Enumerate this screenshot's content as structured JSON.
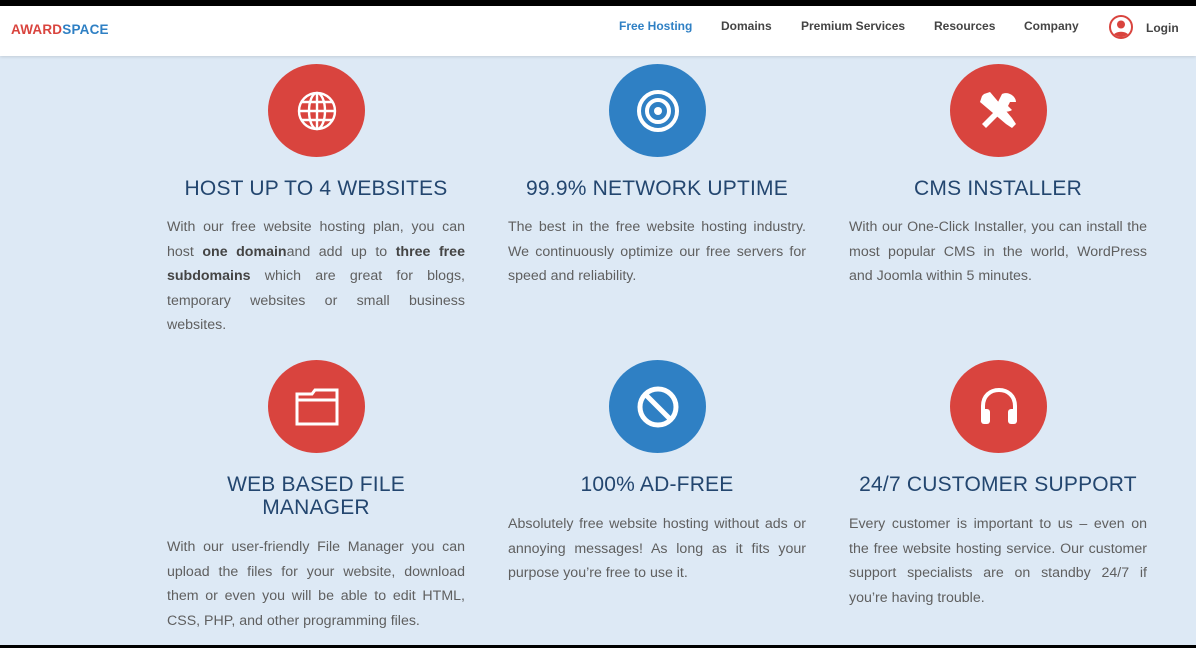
{
  "header": {
    "logo_part1": "AWARD",
    "logo_part2": "SPACE",
    "nav": [
      "Free Hosting",
      "Domains",
      "Premium Services",
      "Resources",
      "Company"
    ],
    "login": "Login"
  },
  "features": [
    {
      "title": "HOST UP TO 4 WEBSITES",
      "desc_1": "With our free website hosting plan, you can host ",
      "desc_bold_1": "one domain",
      "desc_2": "and add up to ",
      "desc_bold_2": "three free subdomains",
      "desc_3": " which are great for blogs, temporary websites or small business websites."
    },
    {
      "title": "99.9% NETWORK UPTIME",
      "desc": "The best in the free website hosting industry. We continuously optimize our free servers for speed and reliability."
    },
    {
      "title": "CMS INSTALLER",
      "desc": "With our One-Click Installer, you can install the most popular CMS in the world, WordPress and Joomla within 5 minutes."
    },
    {
      "title_line1": "WEB BASED FILE",
      "title_line2": "MANAGER",
      "desc": "With our user-friendly File Manager you can upload the files for your website, download them or even you will be able to edit HTML, CSS, PHP, and other programming files."
    },
    {
      "title": "100% AD-FREE",
      "desc": "Absolutely free website hosting without ads or annoying messages! As long as it fits your purpose you’re free to use it."
    },
    {
      "title": "24/7 CUSTOMER SUPPORT",
      "desc": "Every customer is important to us – even on the free website hosting service. Our customer support specialists are on standby 24/7 if you’re having trouble."
    }
  ],
  "colors": {
    "red": "#d9443e",
    "blue": "#2f80c4",
    "title": "#23466f",
    "bg": "#dde9f5"
  },
  "icons": [
    "globe-icon",
    "target-icon",
    "tools-icon",
    "folder-icon",
    "ban-icon",
    "headphones-icon"
  ]
}
